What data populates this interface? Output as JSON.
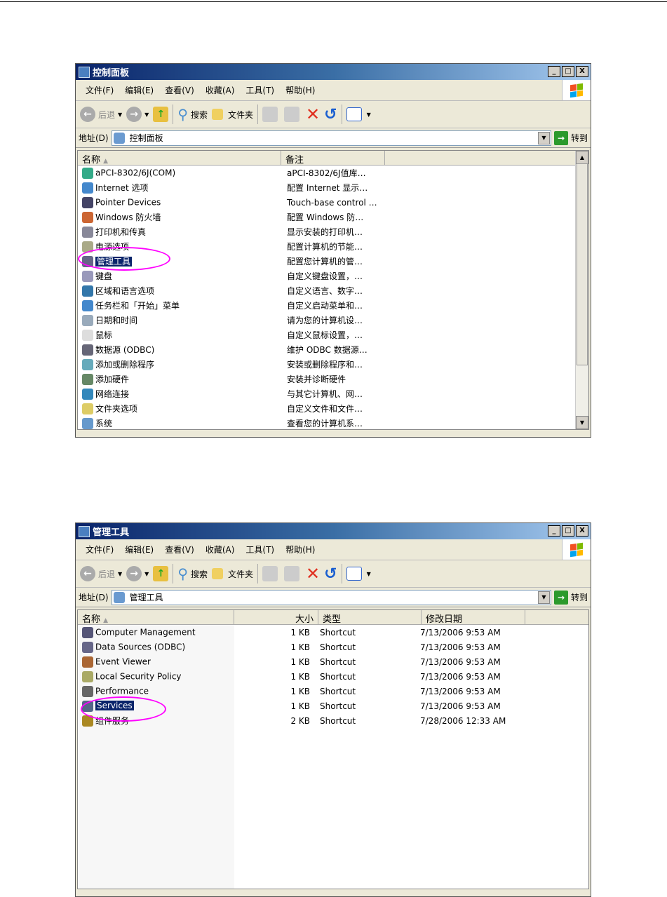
{
  "win1": {
    "title": "控制面板",
    "address": "控制面板",
    "menu": [
      "文件(F)",
      "编辑(E)",
      "查看(V)",
      "收藏(A)",
      "工具(T)",
      "帮助(H)"
    ],
    "toolbar": {
      "back": "后退",
      "search": "搜索",
      "folders": "文件夹"
    },
    "address_label": "地址(D)",
    "go": "转到",
    "columns": [
      "名称",
      "备注"
    ],
    "rows": [
      [
        "aPCI-8302/6J(COM)",
        "aPCI-8302/6J值库…"
      ],
      [
        "Internet 选项",
        "配置 Internet 显示…"
      ],
      [
        "Pointer Devices",
        "Touch-base control …"
      ],
      [
        "Windows 防火墙",
        "配置 Windows 防…"
      ],
      [
        "打印机和传真",
        "显示安装的打印机…"
      ],
      [
        "电源选项",
        "配置计算机的节能…"
      ],
      [
        "管理工具",
        "配置您计算机的管…"
      ],
      [
        "键盘",
        "自定义键盘设置，…"
      ],
      [
        "区域和语言选项",
        "自定义语言、数字…"
      ],
      [
        "任务栏和「开始」菜单",
        "自定义启动菜单和…"
      ],
      [
        "日期和时间",
        "请为您的计算机设…"
      ],
      [
        "鼠标",
        "自定义鼠标设置，…"
      ],
      [
        "数据源 (ODBC)",
        "维护 ODBC 数据源…"
      ],
      [
        "添加或删除程序",
        "安装或删除程序和…"
      ],
      [
        "添加硬件",
        "安装并诊断硬件"
      ],
      [
        "网络连接",
        "与其它计算机、网…"
      ],
      [
        "文件夹选项",
        "自定义文件和文件…"
      ],
      [
        "系统",
        "查看您的计算机系…"
      ]
    ],
    "selected": 6
  },
  "win2": {
    "title": "管理工具",
    "address": "管理工具",
    "menu": [
      "文件(F)",
      "编辑(E)",
      "查看(V)",
      "收藏(A)",
      "工具(T)",
      "帮助(H)"
    ],
    "toolbar": {
      "back": "后退",
      "search": "搜索",
      "folders": "文件夹"
    },
    "address_label": "地址(D)",
    "go": "转到",
    "columns": [
      "名称",
      "大小",
      "类型",
      "修改日期"
    ],
    "rows": [
      [
        "Computer Management",
        "1 KB",
        "Shortcut",
        "7/13/2006 9:53 AM"
      ],
      [
        "Data Sources (ODBC)",
        "1 KB",
        "Shortcut",
        "7/13/2006 9:53 AM"
      ],
      [
        "Event Viewer",
        "1 KB",
        "Shortcut",
        "7/13/2006 9:53 AM"
      ],
      [
        "Local Security Policy",
        "1 KB",
        "Shortcut",
        "7/13/2006 9:53 AM"
      ],
      [
        "Performance",
        "1 KB",
        "Shortcut",
        "7/13/2006 9:53 AM"
      ],
      [
        "Services",
        "1 KB",
        "Shortcut",
        "7/13/2006 9:53 AM"
      ],
      [
        "组件服务",
        "2 KB",
        "Shortcut",
        "7/28/2006 12:33 AM"
      ]
    ],
    "selected": 5
  },
  "colors": {
    "highlight": "#0a246a",
    "circle": "#ff00ff"
  }
}
